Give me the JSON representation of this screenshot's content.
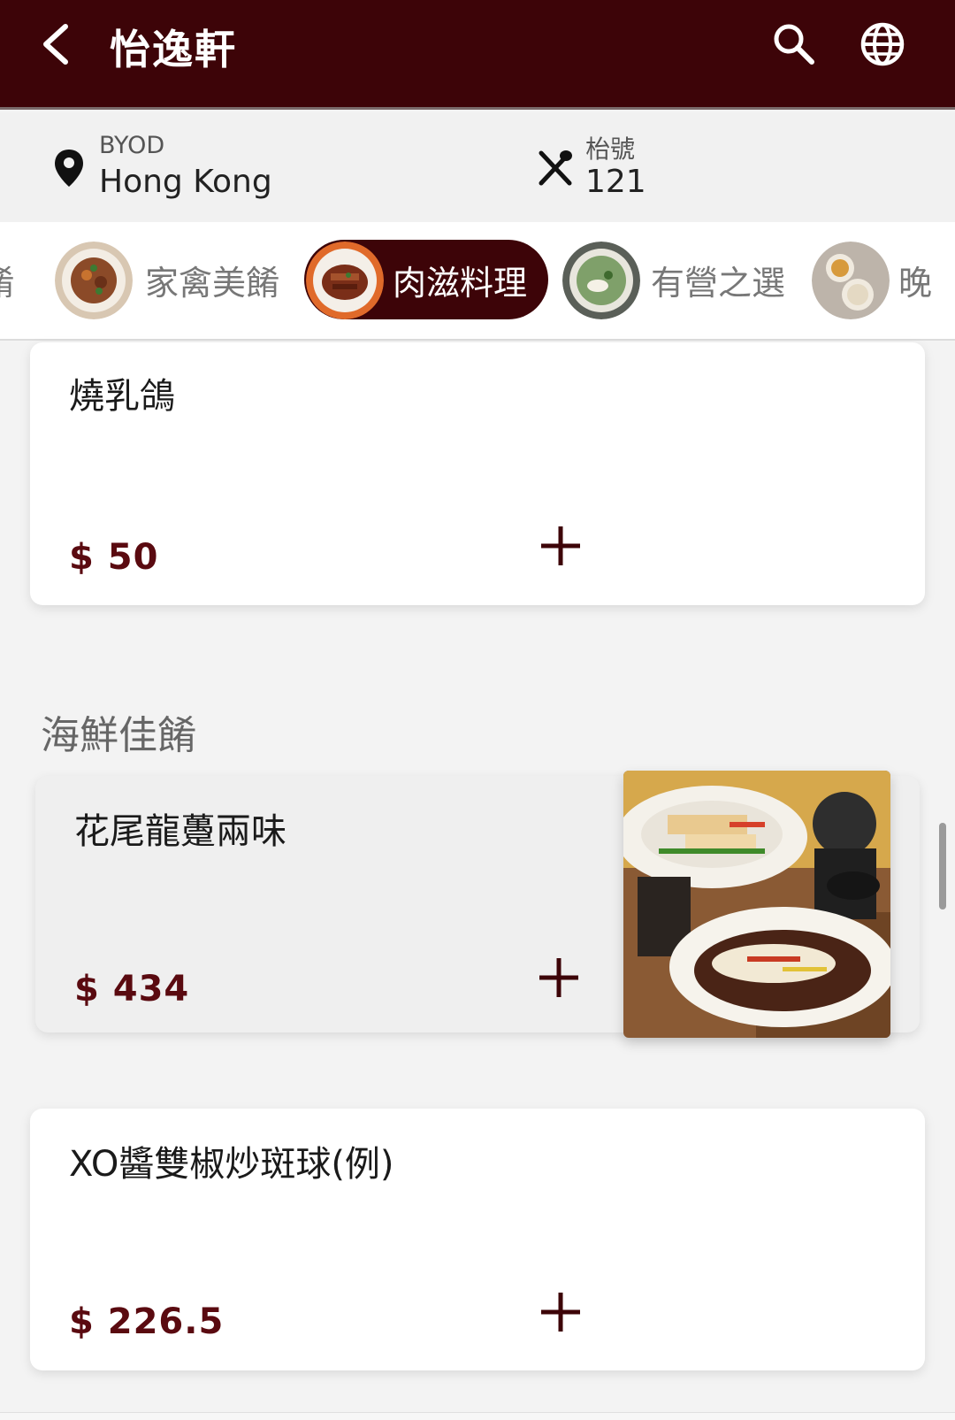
{
  "header": {
    "title": "怡逸軒",
    "back_icon": "chevron-left-icon",
    "search_icon": "search-icon",
    "language_icon": "globe-icon",
    "bg_color": "#3d0408"
  },
  "info": {
    "location_caption": "BYOD",
    "location_value": "Hong Kong",
    "table_caption": "枱號",
    "table_value": "121"
  },
  "categories": [
    {
      "label": "餚",
      "active": false
    },
    {
      "label": "家禽美餚",
      "active": false
    },
    {
      "label": "肉滋料理",
      "active": true
    },
    {
      "label": "有營之選",
      "active": false
    },
    {
      "label": "晚",
      "active": false
    }
  ],
  "menu": {
    "items_top": [
      {
        "name": "燒乳鴿",
        "price": "$ 50"
      }
    ],
    "section_title": "海鮮佳餚",
    "items": [
      {
        "name": "花尾龍躉兩味",
        "price": "$ 434",
        "has_photo": true
      },
      {
        "name": "XO醬雙椒炒斑球(例)",
        "price": "$ 226.5",
        "has_photo": false
      }
    ],
    "add_icon": "plus-icon",
    "accent_color": "#5a0a10"
  }
}
